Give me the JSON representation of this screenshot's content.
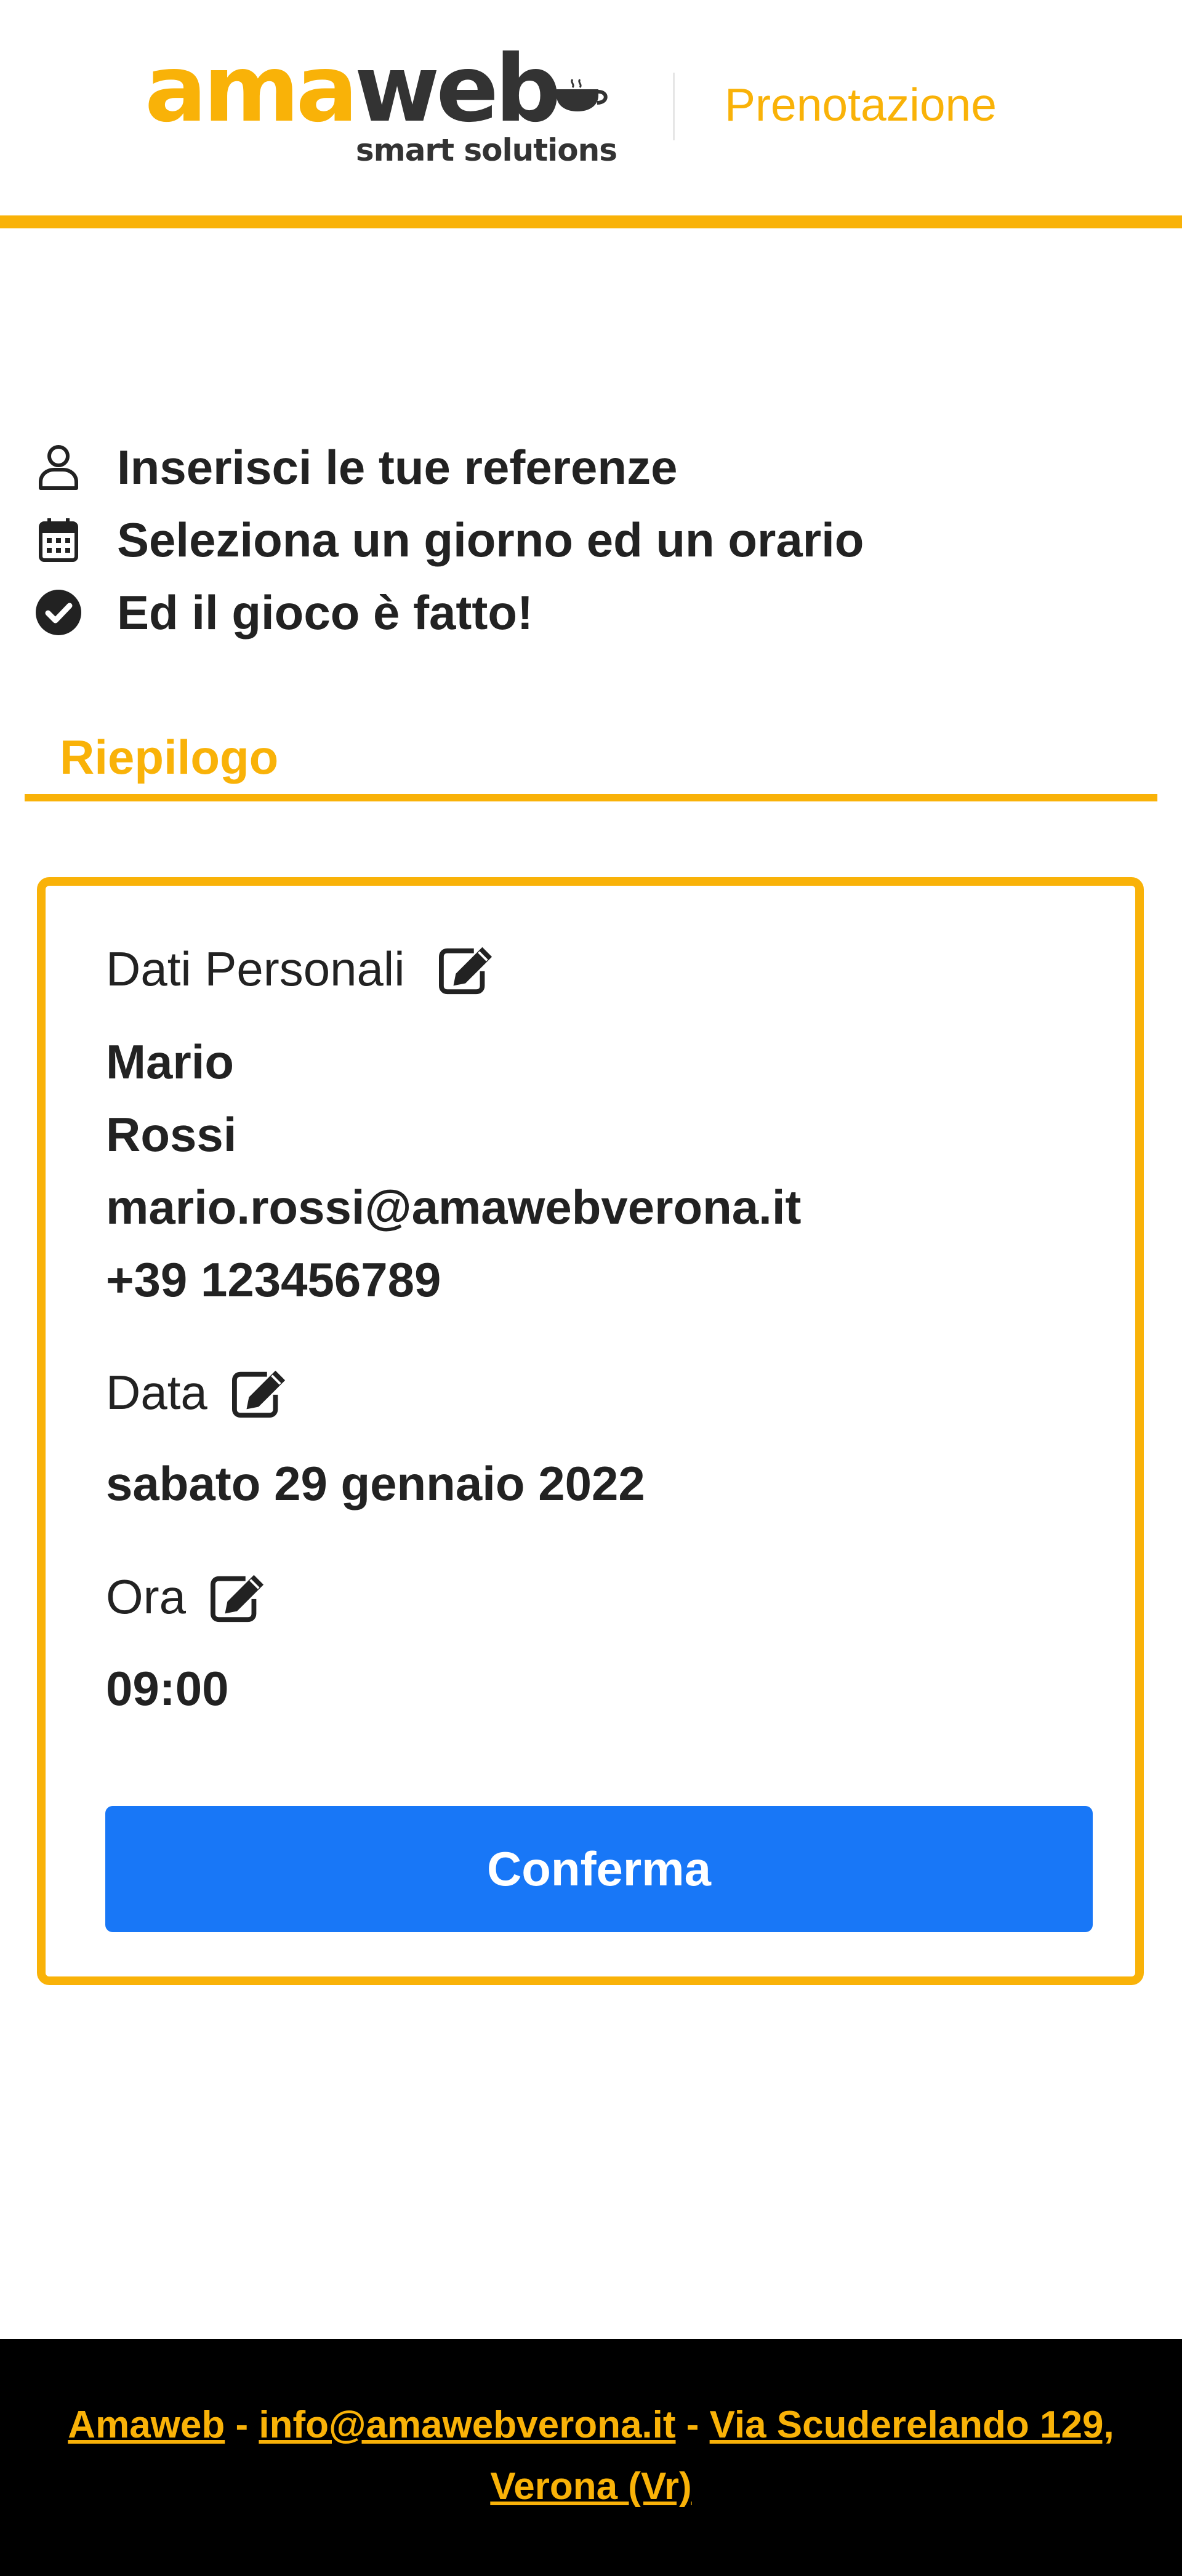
{
  "colors": {
    "accent": "#f9b208",
    "primary_button": "#1877f7",
    "footer_background": "#000000",
    "text": "#222222"
  },
  "header": {
    "logo": {
      "ama": "ama",
      "web": "web",
      "tagline": "smart solutions"
    },
    "nav_link": "Prenotazione"
  },
  "steps": [
    {
      "icon": "user-icon",
      "label": "Inserisci le tue referenze"
    },
    {
      "icon": "calendar-icon",
      "label": "Seleziona un giorno ed un orario"
    },
    {
      "icon": "check-circle-icon",
      "label": "Ed il gioco è fatto!"
    }
  ],
  "summary": {
    "title": "Riepilogo",
    "personal": {
      "label": "Dati Personali",
      "first_name": "Mario",
      "last_name": "Rossi",
      "email": "mario.rossi@amawebverona.it",
      "phone": "+39 123456789"
    },
    "date": {
      "label": "Data",
      "value": "sabato 29 gennaio 2022"
    },
    "time": {
      "label": "Ora",
      "value": "09:00"
    },
    "confirm_label": "Conferma"
  },
  "footer": {
    "company": "Amaweb",
    "separator": " - ",
    "email": "info@amawebverona.it",
    "address": "Via Scuderelando 129, Verona (Vr)"
  }
}
